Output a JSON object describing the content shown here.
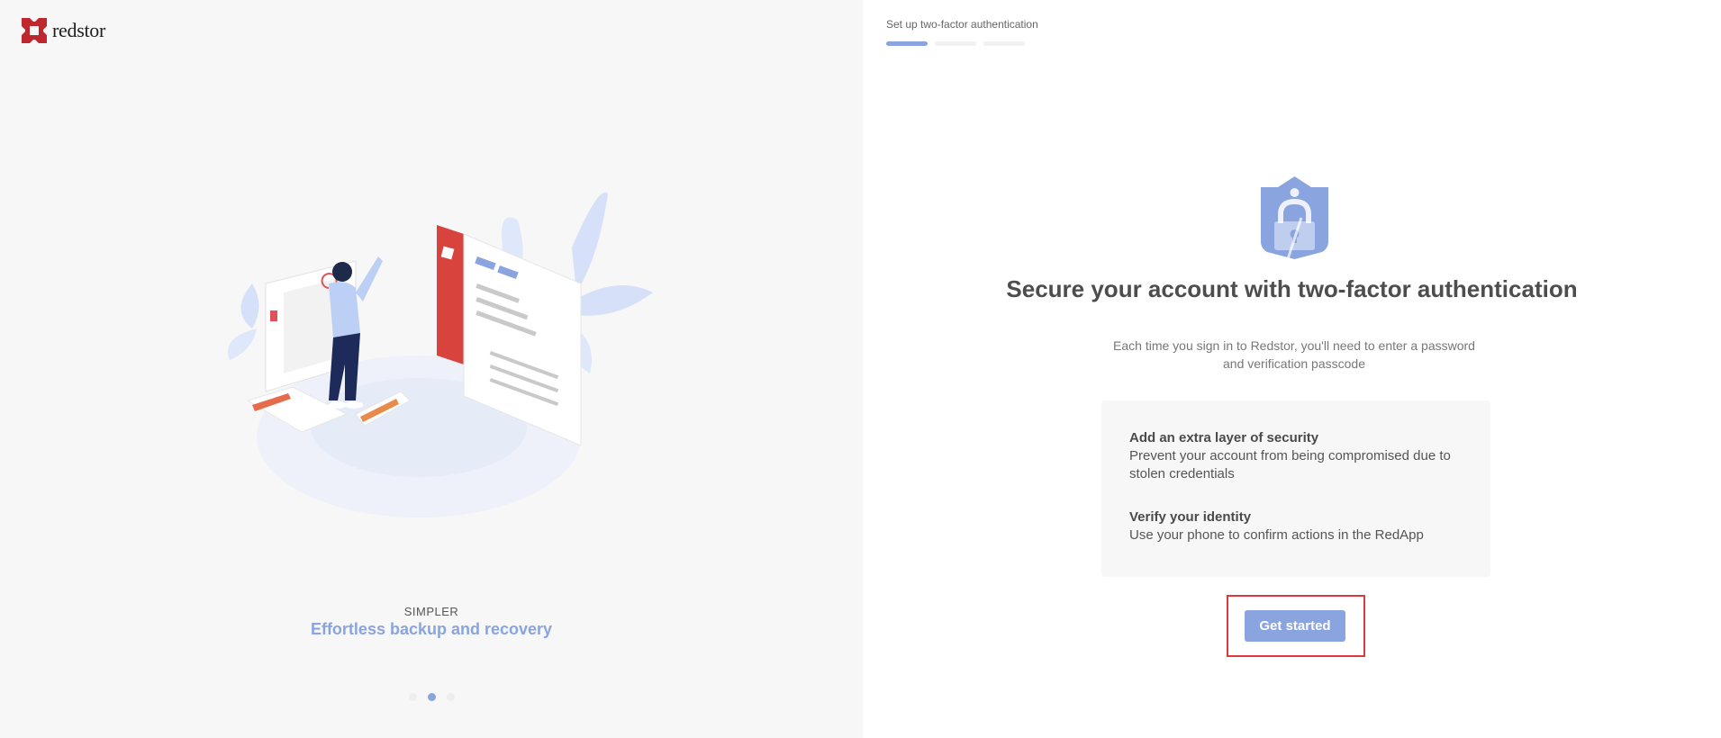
{
  "brand": {
    "name": "redstor"
  },
  "left_panel": {
    "illustration": "person-with-dashboard-illustration",
    "caption_kicker": "SIMPLER",
    "caption_title": "Effortless backup and recovery",
    "carousel": {
      "total": 3,
      "active_index": 1
    }
  },
  "right_panel": {
    "step_label": "Set up two-factor authentication",
    "progress": {
      "total_steps": 3,
      "current_step": 1
    },
    "icon": "shield-lock-icon",
    "headline": "Secure your account with two-factor authentication",
    "subtext": "Each time you sign in to Redstor, you'll need to enter a password and verification passcode",
    "features": [
      {
        "title": "Add an extra layer of security",
        "description": "Prevent your account from being compromised due to stolen credentials"
      },
      {
        "title": "Verify your identity",
        "description": "Use your phone to confirm actions in the RedApp"
      }
    ],
    "cta_label": "Get started"
  },
  "colors": {
    "accent": "#8aa4e0",
    "brand_red": "#c0262d",
    "highlight": "#e0393c",
    "left_bg": "#f7f7f7"
  }
}
